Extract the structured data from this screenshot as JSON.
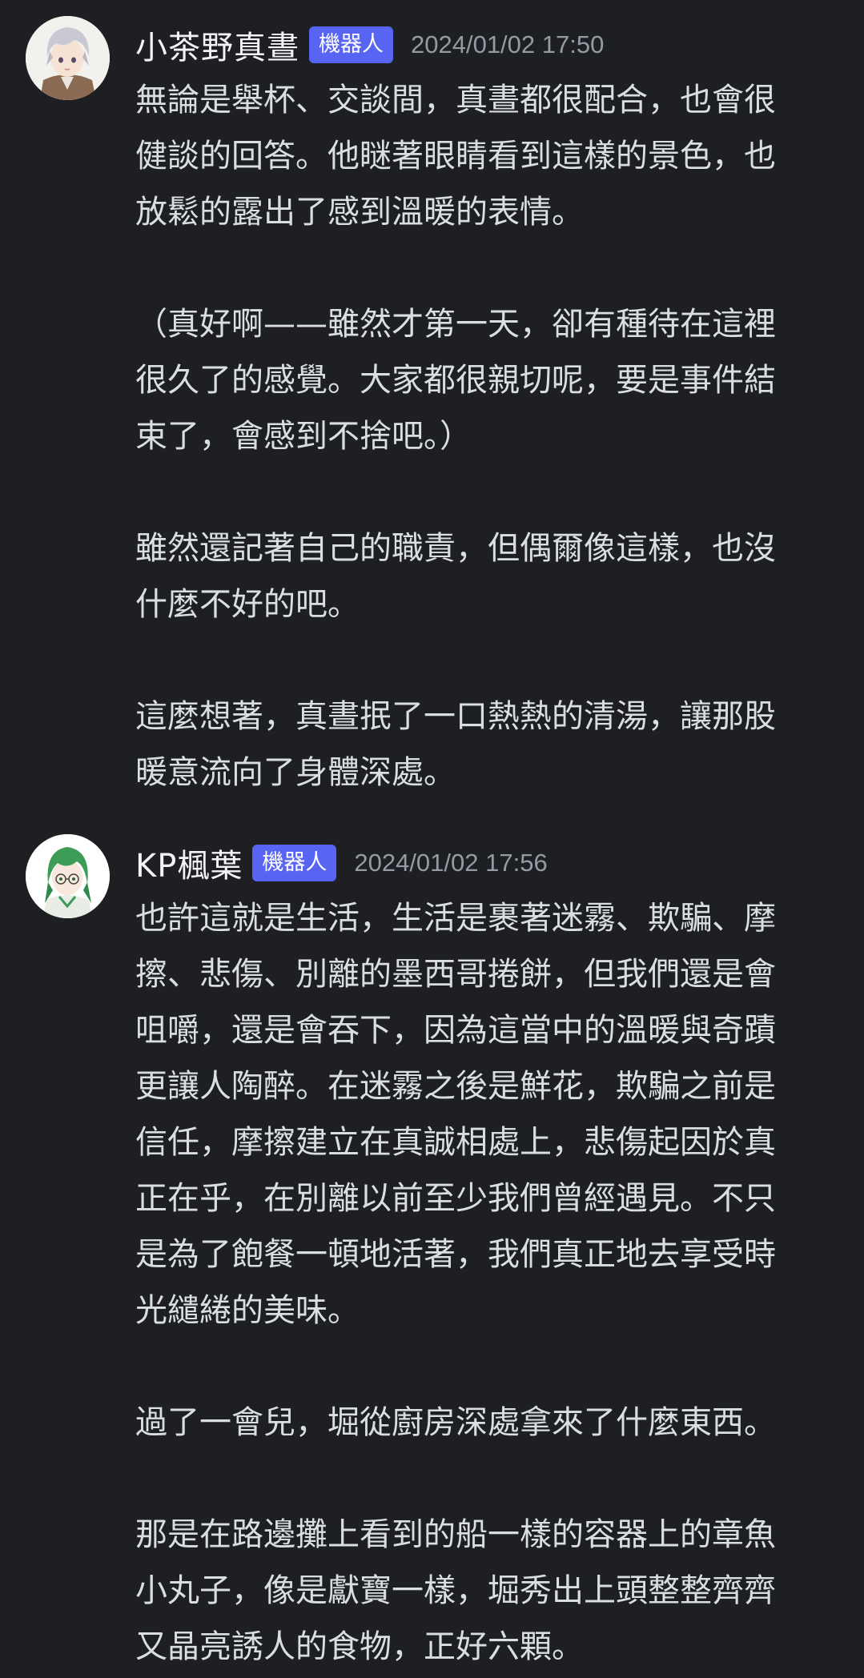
{
  "messages": [
    {
      "username": "小茶野真晝",
      "bot_tag": "機器人",
      "timestamp": "2024/01/02 17:50",
      "avatar_icon": "white-haired-character-avatar",
      "paragraphs": [
        [
          "無論是舉杯、交談間，真晝都很配合，也會很",
          "健談的回答。他瞇著眼睛看到這樣的景色，也",
          "放鬆的露出了感到溫暖的表情。"
        ],
        [
          "（真好啊——雖然才第一天，卻有種待在這裡",
          "很久了的感覺。大家都很親切呢，要是事件結",
          "束了，會感到不捨吧。）"
        ],
        [
          "雖然還記著自己的職責，但偶爾像這樣，也沒",
          "什麼不好的吧。"
        ],
        [
          "這麼想著，真晝抿了一口熱熱的清湯，讓那股",
          "暖意流向了身體深處。"
        ]
      ]
    },
    {
      "username": "KP楓葉",
      "bot_tag": "機器人",
      "timestamp": "2024/01/02 17:56",
      "avatar_icon": "green-haired-character-avatar",
      "paragraphs": [
        [
          "也許這就是生活，生活是裹著迷霧、欺騙、摩",
          "擦、悲傷、別離的墨西哥捲餅，但我們還是會",
          "咀嚼，還是會吞下，因為這當中的溫暖與奇蹟",
          "更讓人陶醉。在迷霧之後是鮮花，欺騙之前是",
          "信任，摩擦建立在真誠相處上，悲傷起因於真",
          "正在乎，在別離以前至少我們曾經遇見。不只",
          "是為了飽餐一頓地活著，我們真正地去享受時",
          "光繾綣的美味。"
        ],
        [
          "過了一會兒，堀從廚房深處拿來了什麼東西。"
        ],
        [
          "那是在路邊攤上看到的船一樣的容器上的章魚",
          "小丸子，像是獻寶一樣，堀秀出上頭整整齊齊",
          "又晶亮誘人的食物，正好六顆。"
        ]
      ]
    }
  ]
}
